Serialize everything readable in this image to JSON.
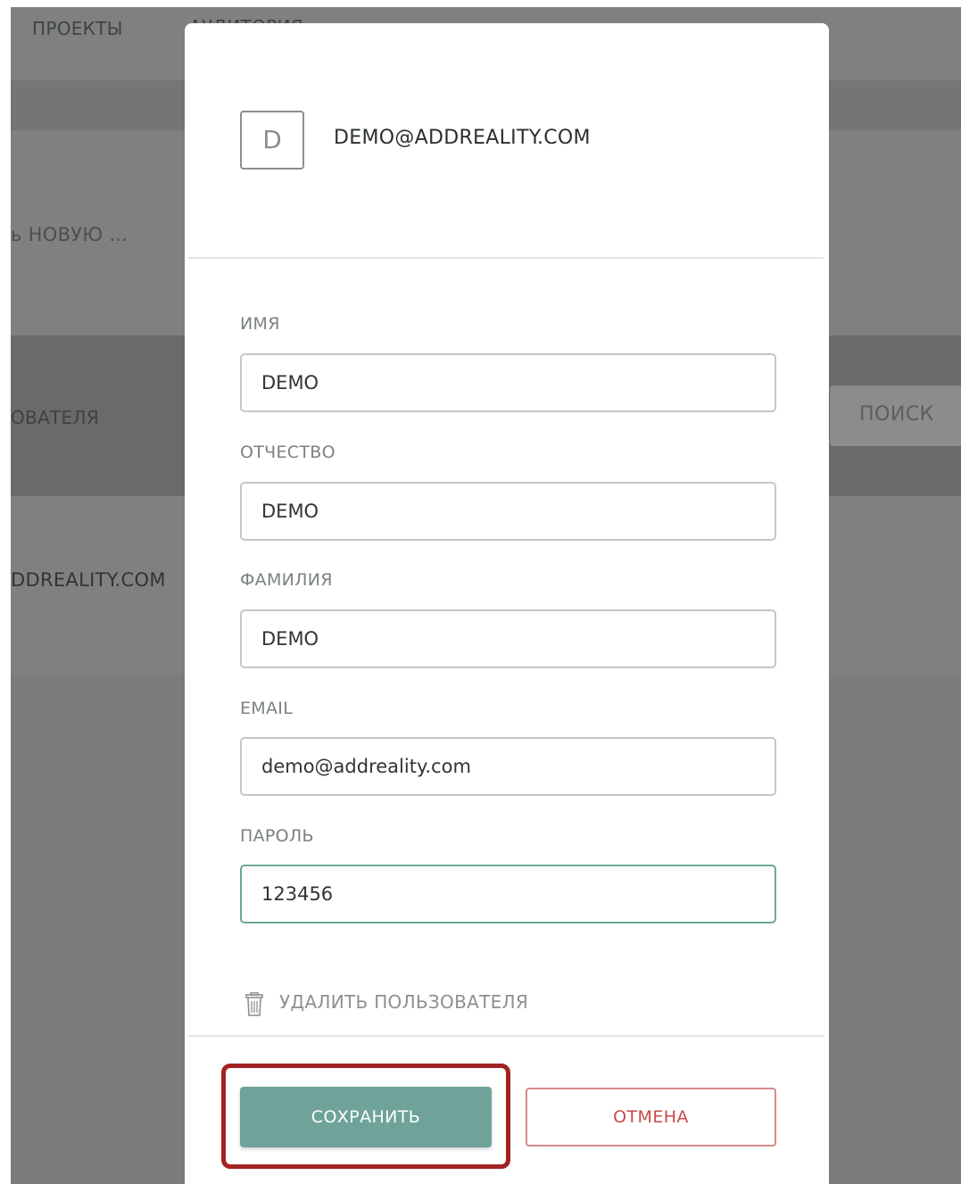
{
  "background": {
    "nav": {
      "projects": "ПРОЕКТЫ",
      "audience": "АУДИТОРИЯ"
    },
    "new_link": "ь НОВУЮ ...",
    "user_column": "ОВАТЕЛЯ",
    "user_email": "DDREALITY.COM",
    "search_button": "ПОИСК"
  },
  "modal": {
    "avatar_letter": "D",
    "header_email": "DEMO@ADDREALITY.COM",
    "fields": [
      {
        "label": "ИМЯ",
        "value": "DEMO"
      },
      {
        "label": "ОТЧЕСТВО",
        "value": "DEMO"
      },
      {
        "label": "ФАМИЛИЯ",
        "value": "DEMO"
      },
      {
        "label": "EMAIL",
        "value": "demo@addreality.com"
      },
      {
        "label": "ПАРОЛЬ",
        "value": "123456"
      }
    ],
    "delete_user": "УДАЛИТЬ ПОЛЬЗОВАТЕЛЯ",
    "delete_icon": "trash-icon",
    "save_label": "СОХРАНИТЬ",
    "cancel_label": "ОТМЕНА"
  },
  "colors": {
    "accent": "#6fa39a",
    "cancel": "#c94a4a",
    "highlight": "#a32222"
  }
}
